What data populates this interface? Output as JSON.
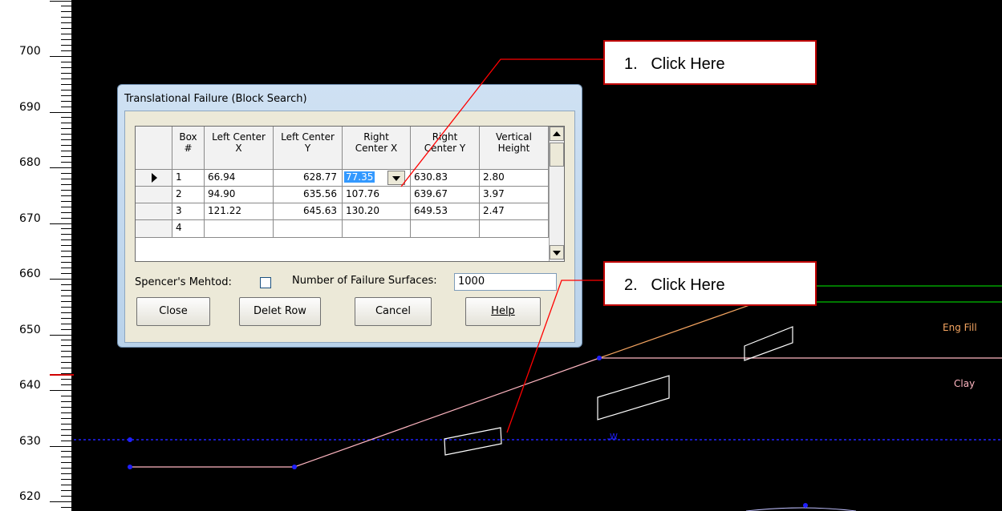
{
  "ruler": {
    "labels": [
      "700",
      "690",
      "680",
      "670",
      "660",
      "650",
      "640",
      "630",
      "620"
    ]
  },
  "plot": {
    "soil_labels": [
      "Eng Fill",
      "Clay"
    ],
    "water_marker": "W"
  },
  "dialog": {
    "title": "Translational Failure (Block Search)",
    "columns": [
      {
        "top": "Box",
        "bottom": "#"
      },
      {
        "top": "Left Center",
        "bottom": "X"
      },
      {
        "top": "Left Center",
        "bottom": "Y"
      },
      {
        "top": "Right",
        "bottom": "Center X"
      },
      {
        "top": "Right",
        "bottom": "Center Y"
      },
      {
        "top": "Vertical",
        "bottom": "Height"
      }
    ],
    "rows": [
      {
        "box": "1",
        "lcx": "66.94",
        "lcy": "628.77",
        "rcx": "77.35",
        "rcy": "630.83",
        "vh": "2.80"
      },
      {
        "box": "2",
        "lcx": "94.90",
        "lcy": "635.56",
        "rcx": "107.76",
        "rcy": "639.67",
        "vh": "3.97"
      },
      {
        "box": "3",
        "lcx": "121.22",
        "lcy": "645.63",
        "rcx": "130.20",
        "rcy": "649.53",
        "vh": "2.47"
      },
      {
        "box": "4",
        "lcx": "",
        "lcy": "",
        "rcx": "",
        "rcy": "",
        "vh": ""
      }
    ],
    "spencer_label": "Spencer's Mehtod:",
    "spencer_checked": false,
    "failure_surfaces_label": "Number of Failure Surfaces:",
    "failure_surfaces_value": "1000",
    "buttons": {
      "close": "Close",
      "delete_row": "Delet Row",
      "cancel": "Cancel",
      "help": "Help"
    }
  },
  "callouts": {
    "first": "1.   Click Here",
    "second": "2.   Click Here"
  },
  "colors": {
    "callout_border": "#c00000",
    "leader_line": "#ff0000",
    "surface_line": "#ffb6c1",
    "fill_line": "#f4a460",
    "green_line": "#00c000",
    "water_line": "#2020ff",
    "selection": "#3399ff"
  }
}
